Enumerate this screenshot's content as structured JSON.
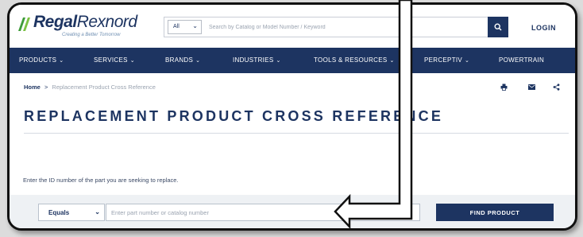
{
  "brand": {
    "name_bold": "Regal",
    "name_thin": "Rexnord",
    "tagline": "Creating a Better Tomorrow"
  },
  "search": {
    "category": "All",
    "placeholder": "Search by Catalog or Model Number / Keyword",
    "button_icon": "search-icon"
  },
  "header": {
    "login_label": "LOGIN"
  },
  "nav": {
    "items": [
      {
        "label": "PRODUCTS",
        "caret": "⌄"
      },
      {
        "label": "SERVICES",
        "caret": "⌄"
      },
      {
        "label": "BRANDS",
        "caret": "⌄"
      },
      {
        "label": "INDUSTRIES",
        "caret": "⌄"
      },
      {
        "label": "TOOLS & RESOURCES",
        "caret": "⌄"
      },
      {
        "label": "PERCEPTIV",
        "caret": "⌄"
      },
      {
        "label": "POWERTRAIN",
        "caret": ""
      }
    ]
  },
  "breadcrumb": {
    "home": "Home",
    "separator": ">",
    "current": "Replacement Product Cross Reference"
  },
  "page": {
    "title": "REPLACEMENT PRODUCT CROSS REFERENCE",
    "instruction": "Enter the ID number of the part you are seeking to replace."
  },
  "form": {
    "match_mode": "Equals",
    "input_placeholder": "Enter part number or catalog number",
    "submit_label": "FIND PRODUCT"
  },
  "share_tools": [
    "print-icon",
    "email-icon",
    "share-icon"
  ],
  "colors": {
    "brand_navy": "#1d3461",
    "band_gray": "#eef1f4",
    "annotation_outline": "#111111"
  }
}
